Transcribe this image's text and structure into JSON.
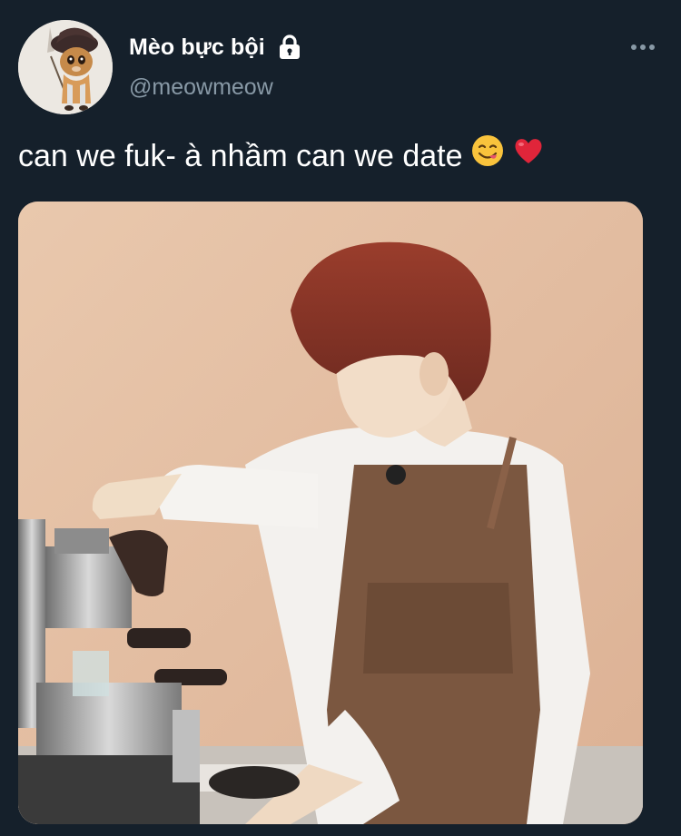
{
  "user": {
    "display_name": "Mèo bực bội",
    "handle": "@meowmeow",
    "protected_icon": "lock-icon",
    "avatar_icon": "cat-avatar"
  },
  "tweet": {
    "text": "can we fuk- à nhầm can we date",
    "emojis": [
      "yum-face-emoji",
      "red-heart-emoji"
    ]
  },
  "menu": {
    "icon": "more-icon"
  },
  "colors": {
    "background": "#15202b",
    "secondary_text": "#8899a6",
    "primary_text": "#ffffff"
  },
  "media": {
    "type": "photo"
  }
}
